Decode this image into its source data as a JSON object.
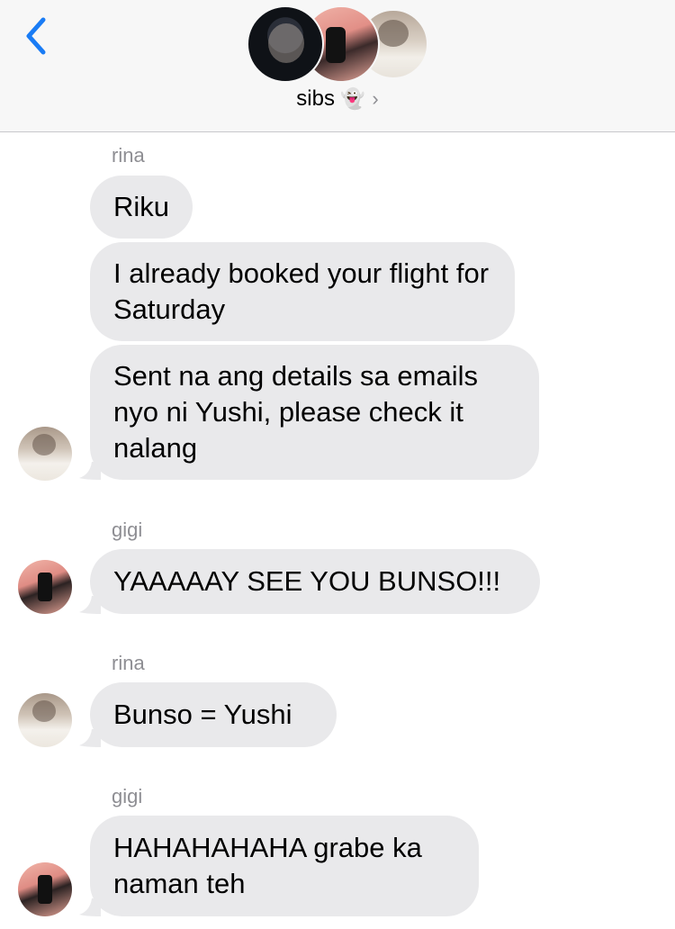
{
  "header": {
    "title": "sibs",
    "title_emoji": "👻",
    "back_glyph": "‹",
    "info_glyph": "›",
    "accent_color": "#1a7cf5"
  },
  "messages": [
    {
      "sender": "rina",
      "texts": [
        "Riku",
        "I already booked your flight for Saturday",
        "Sent na ang details sa emails nyo ni Yushi, please check it nalang"
      ]
    },
    {
      "sender": "gigi",
      "texts": [
        "YAAAAAY SEE YOU BUNSO!!!"
      ]
    },
    {
      "sender": "rina",
      "texts": [
        "Bunso = Yushi"
      ]
    },
    {
      "sender": "gigi",
      "texts": [
        "HAHAHAHAHA grabe ka naman teh"
      ]
    }
  ],
  "colors": {
    "incoming_bubble": "#e9e9eb",
    "sender_label": "#8e8e93",
    "header_bg": "#f7f7f7"
  }
}
